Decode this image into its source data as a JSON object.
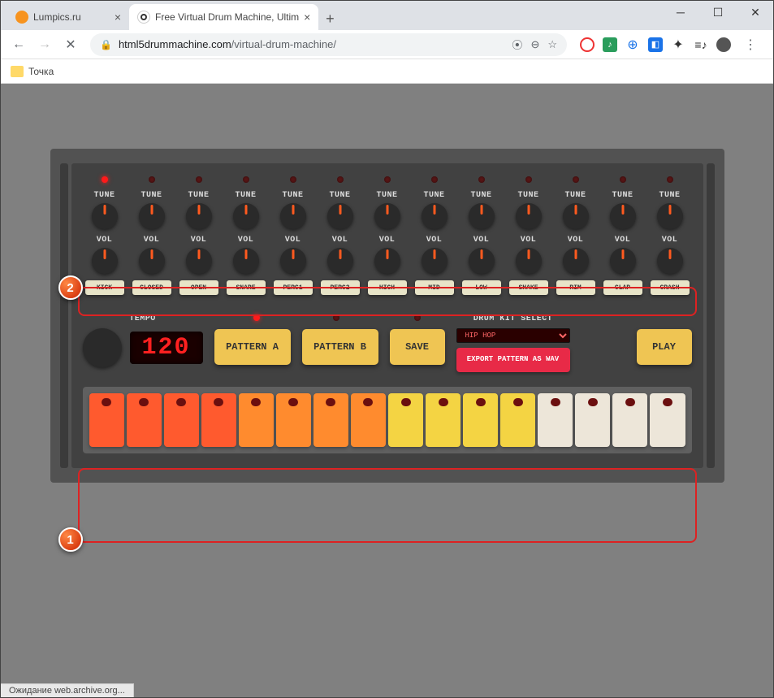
{
  "window": {
    "tabs": [
      {
        "title": "Lumpics.ru",
        "active": false
      },
      {
        "title": "Free Virtual Drum Machine, Ultim",
        "active": true
      }
    ],
    "url_domain": "html5drummachine.com",
    "url_path": "/virtual-drum-machine/",
    "bookmark_folder": "Точка",
    "status_text": "Ожидание web.archive.org..."
  },
  "drum_machine": {
    "tune_label": "TUNE",
    "vol_label": "VOL",
    "channels": [
      {
        "name": "KICK",
        "led_on": true
      },
      {
        "name": "CLOSED",
        "led_on": false
      },
      {
        "name": "OPEN",
        "led_on": false
      },
      {
        "name": "SNARE",
        "led_on": false
      },
      {
        "name": "PERC1",
        "led_on": false
      },
      {
        "name": "PERC2",
        "led_on": false
      },
      {
        "name": "HIGH",
        "led_on": false
      },
      {
        "name": "MID",
        "led_on": false
      },
      {
        "name": "LOW",
        "led_on": false
      },
      {
        "name": "SHAKE",
        "led_on": false
      },
      {
        "name": "RIM",
        "led_on": false
      },
      {
        "name": "CLAP",
        "led_on": false
      },
      {
        "name": "CRASH",
        "led_on": false
      }
    ],
    "tempo_label": "TEMPO",
    "tempo_value": "120",
    "pattern_a": "PATTERN A",
    "pattern_b": "PATTERN B",
    "pattern_a_led_on": true,
    "pattern_b_led_on": false,
    "save": "SAVE",
    "kit_label": "DRUM KIT SELECT",
    "kit_selected": "HIP HOP",
    "export_label": "EXPORT PATTERN AS WAV",
    "play": "PLAY",
    "steps": [
      {
        "color": "c1"
      },
      {
        "color": "c1"
      },
      {
        "color": "c1"
      },
      {
        "color": "c1"
      },
      {
        "color": "c2"
      },
      {
        "color": "c2"
      },
      {
        "color": "c2"
      },
      {
        "color": "c2"
      },
      {
        "color": "c3"
      },
      {
        "color": "c3"
      },
      {
        "color": "c3"
      },
      {
        "color": "c3"
      },
      {
        "color": "c4"
      },
      {
        "color": "c4"
      },
      {
        "color": "c4"
      },
      {
        "color": "c4"
      }
    ]
  },
  "annotations": {
    "badge1": "1",
    "badge2": "2"
  }
}
